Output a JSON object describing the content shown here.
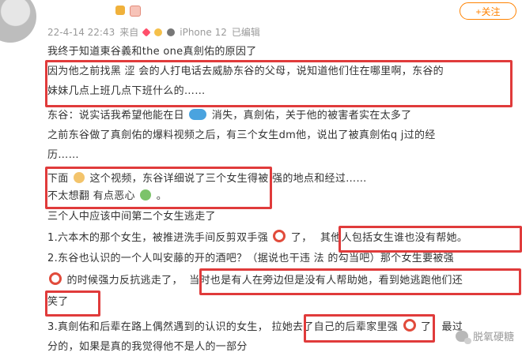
{
  "header": {
    "time": "22-4-14 22:43",
    "source_label": "来自",
    "device": "iPhone 12",
    "edited_label": "已编辑",
    "follow_label": "+关注"
  },
  "post": {
    "lines": [
      "我终于知道東谷義和the one真劍佑的原因了",
      "因为他之前找黑 涩 会的人打电话去威胁东谷的父母，说知道他们住在哪里啊，东谷的",
      "妹妹几点上班几点下班什么的……",
      "东谷：说实话我希望他能在日",
      "消失，真劍佑，关于他的被害者实在太多了",
      "之前东谷做了真劍佑的爆料视频之后，有三个女生dm他，说出了被真劍佑q j过的经",
      "历……",
      "下面",
      "这个视频，东谷详细说了三个女生得被  强的地点和经过……",
      "不太想翻 有点恶心",
      "。",
      "三个人中应该中间第二个女生逃走了",
      "1.六本木的那个女生，被推进洗手间反剪双手强",
      "了，",
      "其他人包括女生谁也没有帮她。",
      "2.东谷也认识的一个人叫安藤的开的酒吧？（据说也干违 法 的勾当吧）那个女生要被强",
      "的时候强力反抗逃走了，",
      "当时也是有人在旁边但是没有人帮助她，看到她逃跑他们还",
      "笑了",
      "3.真劍佑和后辈在路上偶然遇到的认识的女生，",
      "拉她去了自己的后辈家里强",
      "了，最过",
      "分的，如果是真的我觉得他不是人的一部分"
    ]
  },
  "watermark": {
    "label": "脱氧硬糖"
  },
  "colors": {
    "highlight": "#e03b3b",
    "follow": "#ff8200"
  }
}
